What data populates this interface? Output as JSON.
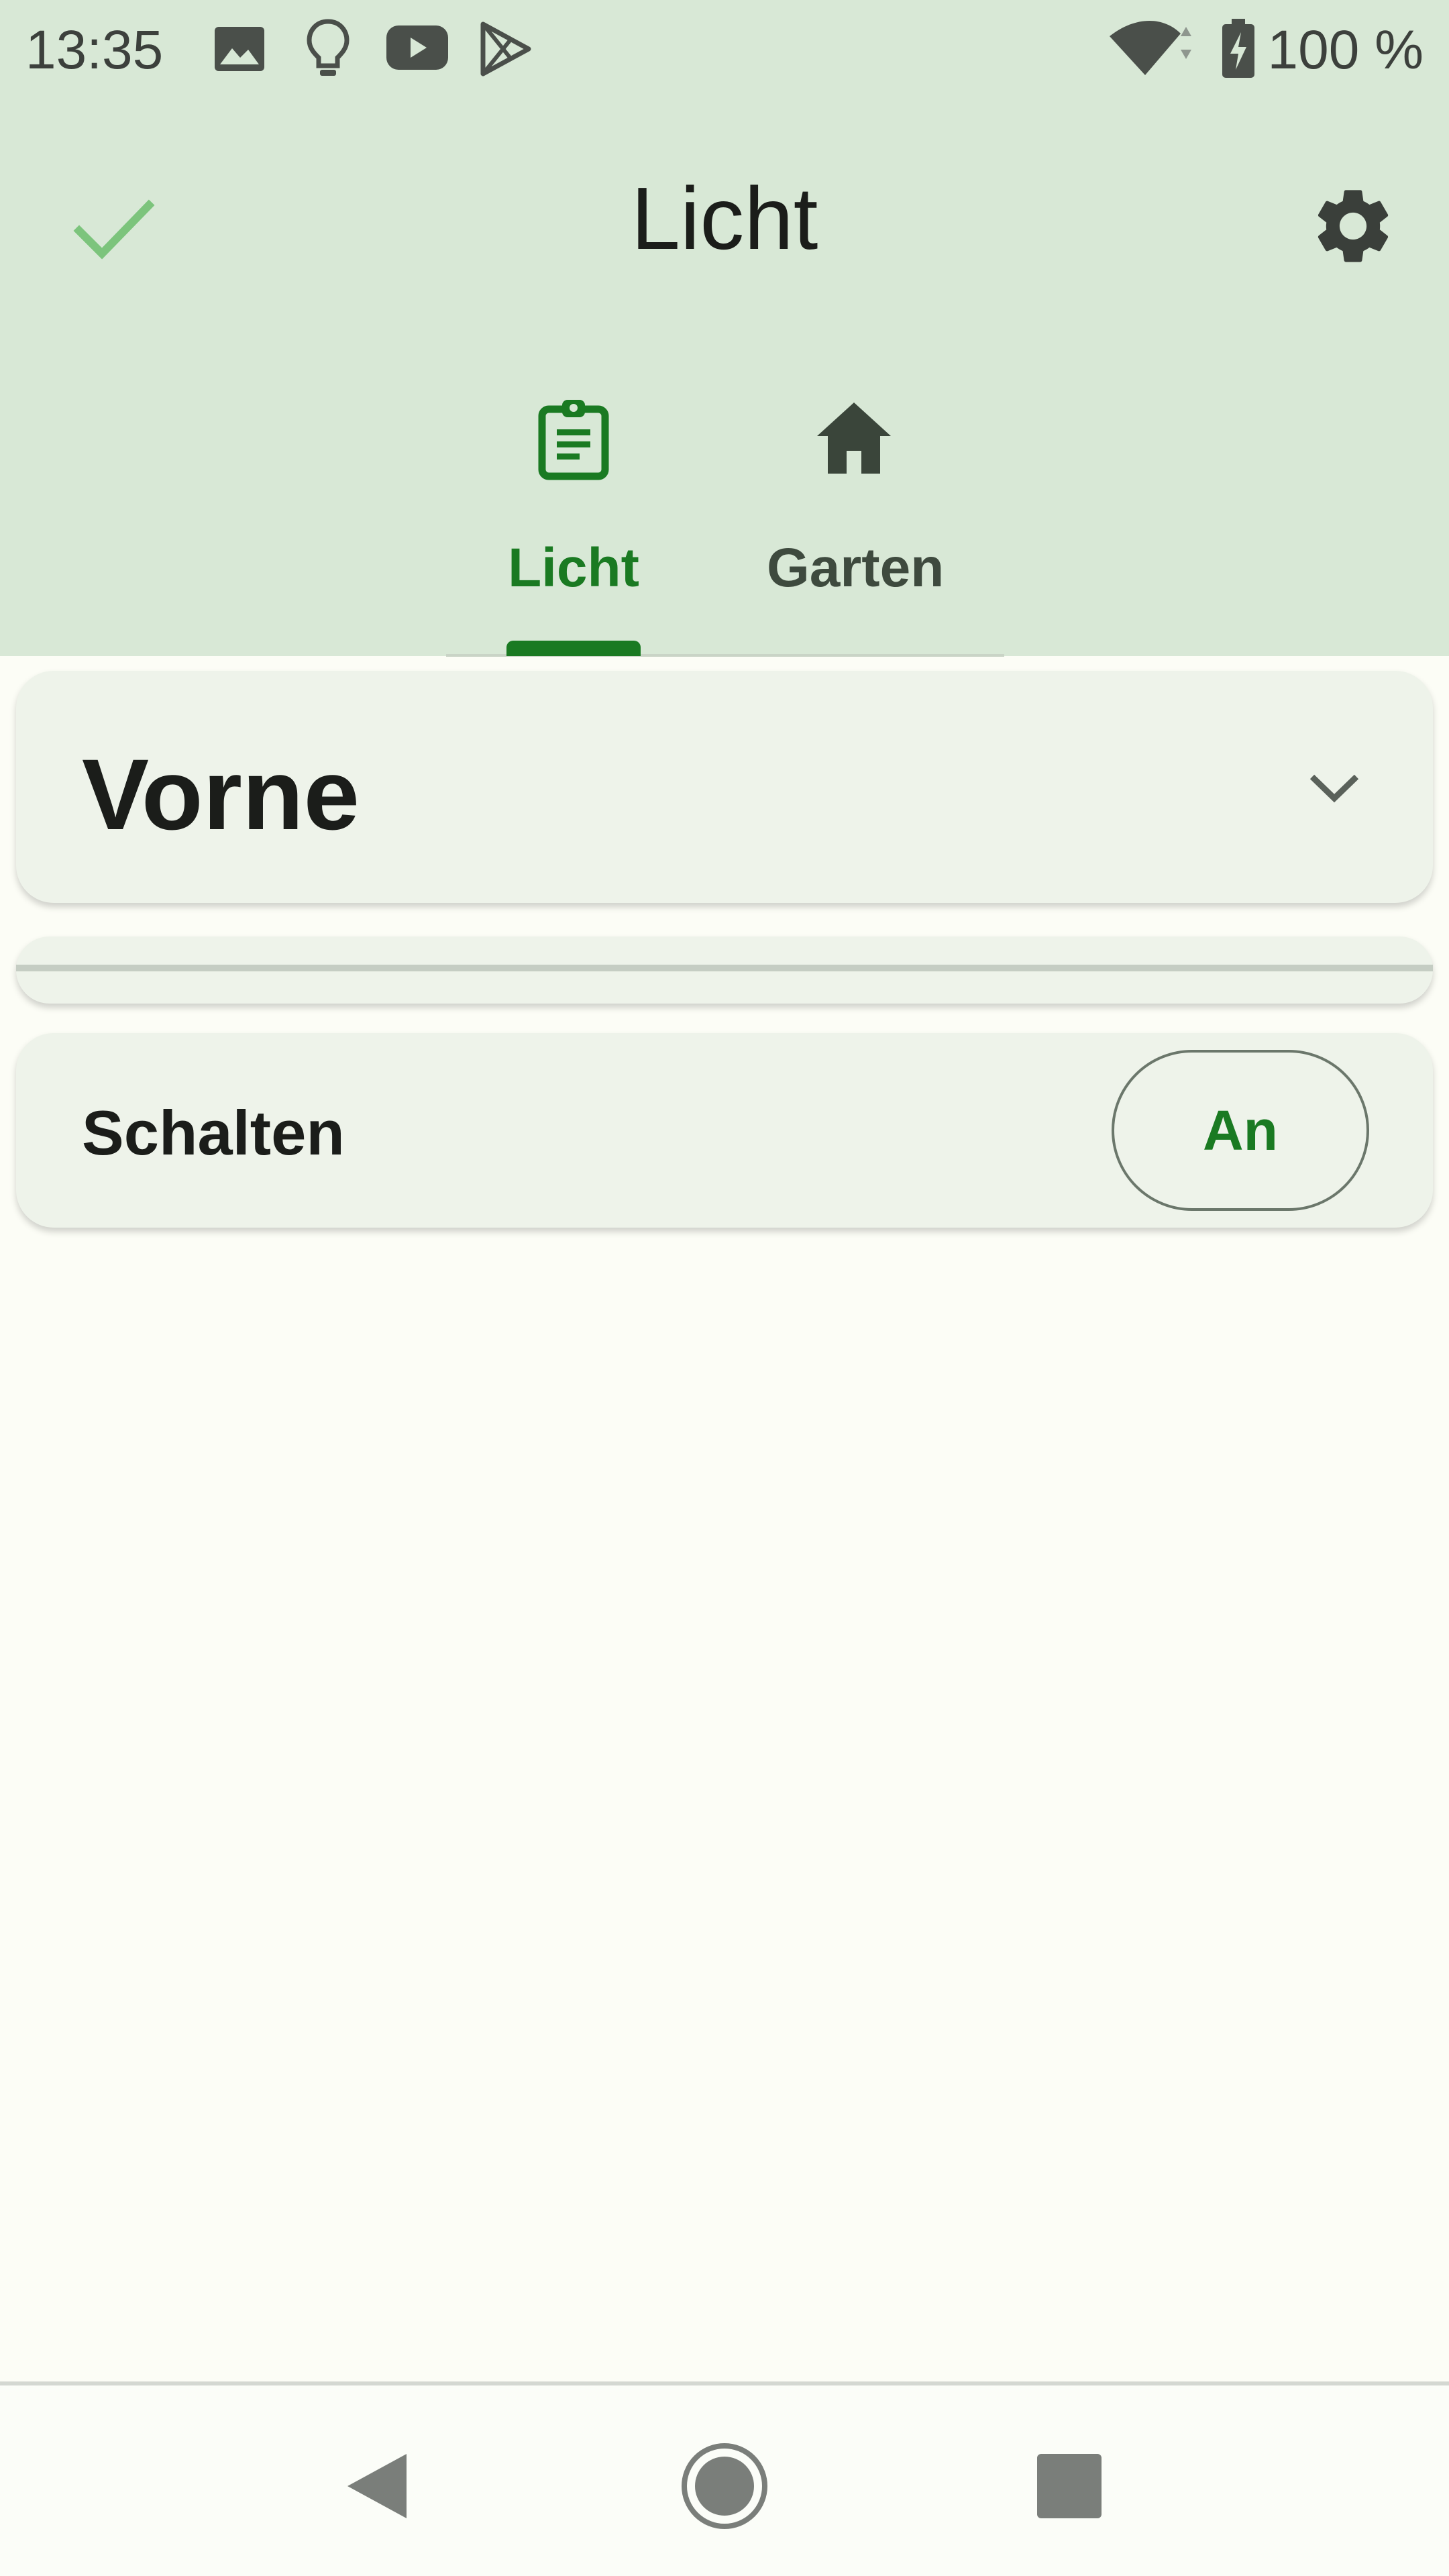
{
  "status_bar": {
    "time": "13:35",
    "battery_text": "100 %",
    "icons": [
      "image-icon",
      "lightbulb-icon",
      "youtube-icon",
      "play-store-icon",
      "wifi-icon",
      "battery-charging-icon"
    ]
  },
  "app_bar": {
    "title": "Licht",
    "left_icon": "check-icon",
    "right_icon": "gear-icon"
  },
  "tabs": [
    {
      "label": "Licht",
      "icon": "clipboard-icon",
      "selected": true
    },
    {
      "label": "Garten",
      "icon": "home-icon",
      "selected": false
    }
  ],
  "cards": {
    "group_title": "Vorne",
    "switch_label": "Schalten",
    "switch_button": "An"
  },
  "colors": {
    "header_bg": "#d8e8d6",
    "accent": "#1a7a22",
    "check": "#7cc47c",
    "card_bg": "#eef3ea",
    "page_bg": "#fcfdf6"
  },
  "nav": [
    "back-icon",
    "home-circle-icon",
    "recents-icon"
  ]
}
